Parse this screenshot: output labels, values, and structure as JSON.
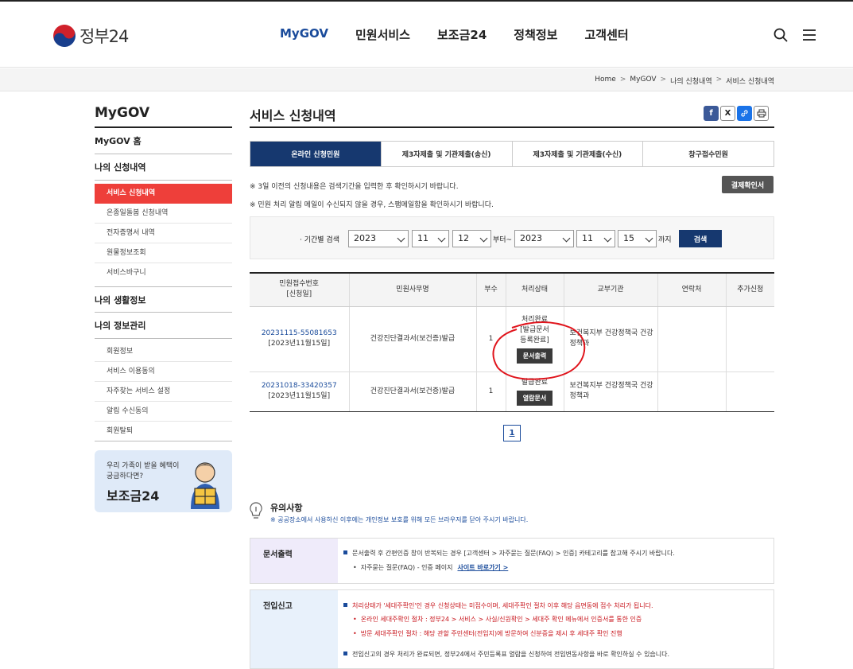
{
  "header": {
    "logo_text": "정부24",
    "nav": [
      "MyGOV",
      "민원서비스",
      "보조금24",
      "정책정보",
      "고객센터"
    ],
    "active_nav": "MyGOV"
  },
  "breadcrumb": [
    "Home",
    "MyGOV",
    "나의 신청내역",
    "서비스 신청내역"
  ],
  "sidebar": {
    "title": "MyGOV",
    "home": "MyGOV 홈",
    "group1": {
      "title": "나의 신청내역",
      "items": [
        "서비스 신청내역",
        "온종일돌봄 신청내역",
        "전자증명서 내역",
        "원물정보조회",
        "서비스바구니"
      ]
    },
    "group2": {
      "title": "나의 생활정보"
    },
    "group3": {
      "title": "나의 정보관리",
      "items": [
        "회원정보",
        "서비스 이용동의",
        "자주찾는 서비스 설정",
        "알림 수신동의",
        "회원탈퇴"
      ]
    },
    "banner": {
      "line1": "우리 가족이 받을 혜택이 궁금하다면?",
      "line2": "보조금24"
    }
  },
  "main": {
    "title": "서비스 신청내역",
    "share_icons": [
      "f",
      "X",
      "link",
      "print"
    ],
    "tabs": [
      "온라인 신청민원",
      "제3자제출 및 기관제출(송신)",
      "제3자제출 및 기관제출(수신)",
      "창구접수민원"
    ],
    "note1": "※ 3일 이전의 신청내용은 검색기간을 입력한 후 확인하시기 바랍니다.",
    "note2": "※ 민원 처리 알림 메일이 수신되지 않을 경우, 스팸메일함을 확인하시기 바랍니다.",
    "pay_confirm_button": "결제확인서",
    "search": {
      "label": "· 기간별 검색",
      "from_year": "2023",
      "from_month": "11",
      "from_day": "12",
      "from_suffix": "부터~",
      "to_year": "2023",
      "to_month": "11",
      "to_day": "15",
      "to_suffix": "까지",
      "button": "검색"
    },
    "table": {
      "headers": [
        "민원접수번호\n[신청일]",
        "민원사무명",
        "부수",
        "처리상태",
        "교부기관",
        "연락처",
        "추가신청"
      ],
      "rows": [
        {
          "receipt_no": "20231115-55081653",
          "date": "[2023년11월15일]",
          "service": "건강진단결과서(보건증)발급",
          "copies": "1",
          "status": "처리완료\n[발급문서\n등록완료]",
          "action": "문서출력",
          "agency": "보건복지부 건강정책국 건강정책과",
          "contact": "",
          "extra": ""
        },
        {
          "receipt_no": "20231018-33420357",
          "date": "[2023년11월15일]",
          "service": "건강진단결과서(보건증)발급",
          "copies": "1",
          "status": "발급완료",
          "action": "열람문서",
          "agency": "보건복지부 건강정책국 건강정책과",
          "contact": "",
          "extra": ""
        }
      ]
    },
    "pagination": [
      "1"
    ]
  },
  "caution": {
    "title": "유의사항",
    "subtitle": "※ 공공장소에서 사용하신 이후에는 개인정보 보호를 위해 모든 브라우저를 닫아 주시기 바랍니다.",
    "box1": {
      "head": "문서출력",
      "line1": "문서출력 후 간편인증 창이 반복되는 경우 [고객센터 > 자주묻는 질문(FAQ) > 인증] 카테고리를 참고해 주시기 바랍니다.",
      "line2": "자주묻는 질문(FAQ) - 인증 페이지",
      "link": "사이트 바로가기 >"
    },
    "box2": {
      "head": "전입신고",
      "line1": "처리상태가 '세대주확인'인 경우 신청상태는 미접수이며, 세대주확인 절차 이후 해당 읍면동에 접수 처리가 됩니다.",
      "line2": "온라인 세대주확인 절차 : 정부24 > 서비스 > 사실/신원확인 > 세대주 확인 메뉴에서 인증서를 통한 인증",
      "line3": "방문 세대주확인 절차 : 해당 관할 주민센터(전입지)에 방문하여 신분증을 제시 후 세대주 확인 진행",
      "line4": "전입신고의 경우 처리가 완료되면, 정부24에서 주민등록표 열람을 신청하여 전입변동사항을 바로 확인하실 수 있습니다."
    }
  },
  "annotation": {
    "color": "#e0141c"
  }
}
